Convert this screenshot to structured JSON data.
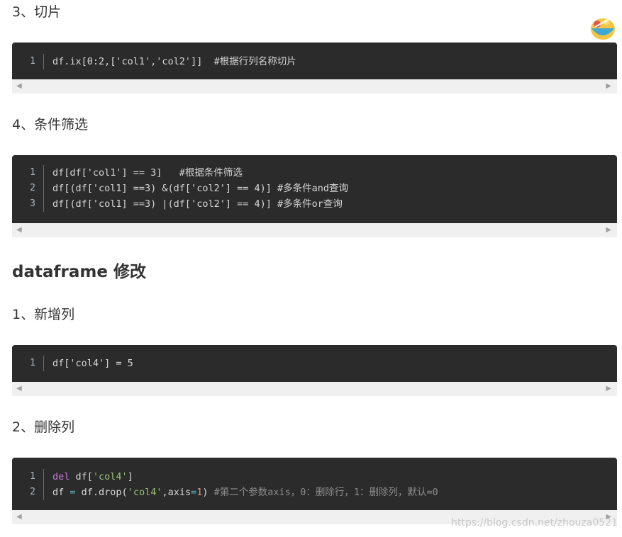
{
  "sections": [
    {
      "heading": "3、切片"
    },
    {
      "heading": "4、条件筛选"
    },
    {
      "heading": "dataframe 修改"
    },
    {
      "heading": "1、新增列"
    },
    {
      "heading": "2、删除列"
    }
  ],
  "code_blocks": [
    {
      "lines": [
        {
          "num": "1",
          "code": "df.ix[0:2,['col1','col2']]  #根据行列名称切片"
        }
      ]
    },
    {
      "lines": [
        {
          "num": "1",
          "code": "df[df['col1'] == 3]   #根据条件筛选"
        },
        {
          "num": "2",
          "code": "df[(df['col1] ==3) &(df['col2'] == 4)] #多条件and查询"
        },
        {
          "num": "3",
          "code": "df[(df['col1] ==3) |(df['col2'] == 4)] #多条件or查询"
        }
      ]
    },
    {
      "lines": [
        {
          "num": "1",
          "code": "df['col4'] = 5"
        }
      ]
    },
    {
      "lines": [
        {
          "num": "1",
          "tokens": {
            "kw": "del",
            "plain1": " df[",
            "str": "'col4'",
            "plain2": "]"
          }
        },
        {
          "num": "2",
          "tokens": {
            "a": "df ",
            "op": "=",
            "b": " df.drop(",
            "str": "'col4'",
            "c": ",axis",
            "op2": "=",
            "num": "1",
            "d": ") ",
            "cm": "#第二个参数axis，0：删除行，1：删除列，默认=0"
          }
        }
      ]
    }
  ],
  "scroll_arrows": {
    "left": "◀",
    "right": "▶"
  },
  "mascot_icon": "food-bowl-icon",
  "watermark": "https://blog.csdn.net/zhouza0521"
}
